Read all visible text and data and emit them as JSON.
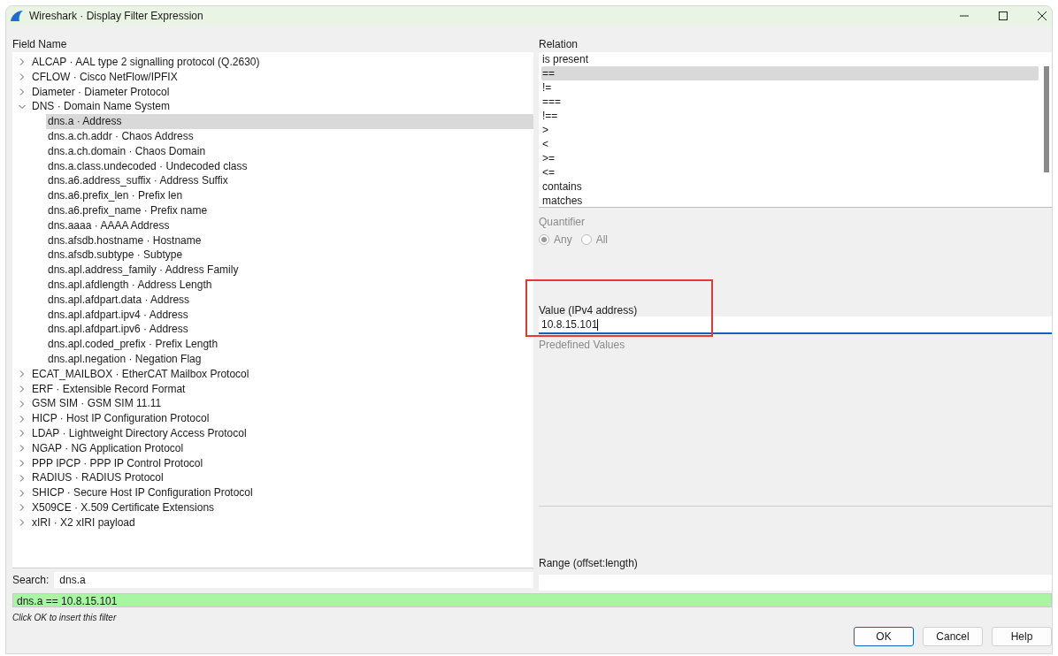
{
  "window": {
    "title": "Wireshark · Display Filter Expression"
  },
  "field_name": {
    "label": "Field Name",
    "items": [
      {
        "label": "ALCAP · AAL type 2 signalling protocol (Q.2630)",
        "expanded": false,
        "selected": false
      },
      {
        "label": "CFLOW · Cisco NetFlow/IPFIX",
        "expanded": false,
        "selected": false
      },
      {
        "label": "Diameter · Diameter Protocol",
        "expanded": false,
        "selected": false
      },
      {
        "label": "DNS · Domain Name System",
        "expanded": true,
        "selected": false,
        "children": [
          {
            "label": "dns.a · Address",
            "selected": true
          },
          {
            "label": "dns.a.ch.addr · Chaos Address",
            "selected": false
          },
          {
            "label": "dns.a.ch.domain · Chaos Domain",
            "selected": false
          },
          {
            "label": "dns.a.class.undecoded · Undecoded class",
            "selected": false
          },
          {
            "label": "dns.a6.address_suffix · Address Suffix",
            "selected": false
          },
          {
            "label": "dns.a6.prefix_len · Prefix len",
            "selected": false
          },
          {
            "label": "dns.a6.prefix_name · Prefix name",
            "selected": false
          },
          {
            "label": "dns.aaaa · AAAA Address",
            "selected": false
          },
          {
            "label": "dns.afsdb.hostname · Hostname",
            "selected": false
          },
          {
            "label": "dns.afsdb.subtype · Subtype",
            "selected": false
          },
          {
            "label": "dns.apl.address_family · Address Family",
            "selected": false
          },
          {
            "label": "dns.apl.afdlength · Address Length",
            "selected": false
          },
          {
            "label": "dns.apl.afdpart.data · Address",
            "selected": false
          },
          {
            "label": "dns.apl.afdpart.ipv4 · Address",
            "selected": false
          },
          {
            "label": "dns.apl.afdpart.ipv6 · Address",
            "selected": false
          },
          {
            "label": "dns.apl.coded_prefix · Prefix Length",
            "selected": false
          },
          {
            "label": "dns.apl.negation · Negation Flag",
            "selected": false
          }
        ]
      },
      {
        "label": "ECAT_MAILBOX · EtherCAT Mailbox Protocol",
        "expanded": false,
        "selected": false
      },
      {
        "label": "ERF · Extensible Record Format",
        "expanded": false,
        "selected": false
      },
      {
        "label": "GSM SIM · GSM SIM 11.11",
        "expanded": false,
        "selected": false
      },
      {
        "label": "HICP · Host IP Configuration Protocol",
        "expanded": false,
        "selected": false
      },
      {
        "label": "LDAP · Lightweight Directory Access Protocol",
        "expanded": false,
        "selected": false
      },
      {
        "label": "NGAP · NG Application Protocol",
        "expanded": false,
        "selected": false
      },
      {
        "label": "PPP IPCP · PPP IP Control Protocol",
        "expanded": false,
        "selected": false
      },
      {
        "label": "RADIUS · RADIUS Protocol",
        "expanded": false,
        "selected": false
      },
      {
        "label": "SHICP · Secure Host IP Configuration Protocol",
        "expanded": false,
        "selected": false
      },
      {
        "label": "X509CE · X.509 Certificate Extensions",
        "expanded": false,
        "selected": false
      },
      {
        "label": "xIRI · X2 xIRI payload",
        "expanded": false,
        "selected": false
      }
    ]
  },
  "relation": {
    "label": "Relation",
    "items": [
      {
        "label": "is present",
        "selected": false
      },
      {
        "label": "==",
        "selected": true
      },
      {
        "label": "!=",
        "selected": false
      },
      {
        "label": "===",
        "selected": false
      },
      {
        "label": "!==",
        "selected": false
      },
      {
        "label": ">",
        "selected": false
      },
      {
        "label": "<",
        "selected": false
      },
      {
        "label": ">=",
        "selected": false
      },
      {
        "label": "<=",
        "selected": false
      },
      {
        "label": "contains",
        "selected": false
      },
      {
        "label": "matches",
        "selected": false
      }
    ]
  },
  "quantifier": {
    "label": "Quantifier",
    "disabled": true,
    "options": [
      {
        "label": "Any",
        "selected": true
      },
      {
        "label": "All",
        "selected": false
      }
    ]
  },
  "value": {
    "label": "Value (IPv4 address)",
    "value": "10.8.15.101",
    "highlighted": true
  },
  "predefined_values": {
    "label": "Predefined Values"
  },
  "range": {
    "label": "Range (offset:length)"
  },
  "search": {
    "label": "Search:",
    "value": "dns.a"
  },
  "filter": {
    "value": "dns.a == 10.8.15.101",
    "valid": true
  },
  "hint": "Click OK to insert this filter",
  "buttons": [
    "OK",
    "Cancel",
    "Help"
  ]
}
